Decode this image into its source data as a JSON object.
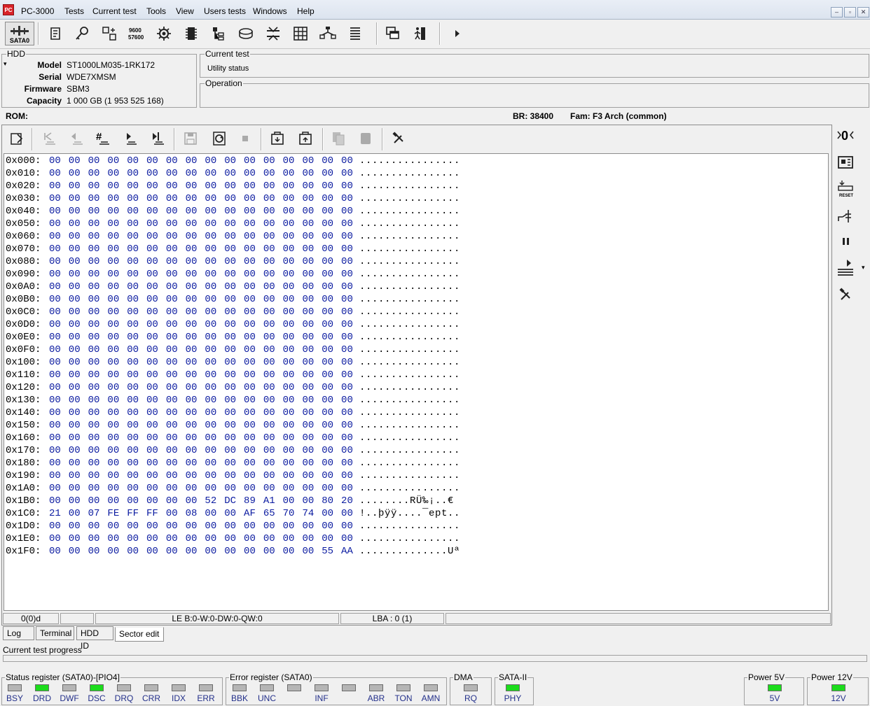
{
  "window": {
    "title_icon": "pc3000-icon",
    "menu": [
      "PC-3000",
      "Tests",
      "Current test",
      "Tools",
      "View",
      "Users tests",
      "Windows",
      "Help"
    ]
  },
  "toolbar": {
    "port_label": "SATA0"
  },
  "hdd": {
    "group_title": "HDD",
    "labels": {
      "model": "Model",
      "serial": "Serial",
      "firmware": "Firmware",
      "capacity": "Capacity"
    },
    "model": "ST1000LM035-1RK172",
    "serial": "WDE7XMSM",
    "firmware": "SBM3",
    "capacity": "1 000 GB (1 953 525 168)"
  },
  "current_test": {
    "title": "Current test",
    "value": "Utility status"
  },
  "operation": {
    "title": "Operation",
    "value": ""
  },
  "rom_line": {
    "rom": "ROM:",
    "br": "BR: 38400",
    "fam": "Fam: F3 Arch (common)"
  },
  "hex": {
    "rows": [
      {
        "addr": "0x000:",
        "bytes": "00 00 00 00 00 00 00 00 00 00 00 00 00 00 00 00",
        "ascii": "................"
      },
      {
        "addr": "0x010:",
        "bytes": "00 00 00 00 00 00 00 00 00 00 00 00 00 00 00 00",
        "ascii": "................"
      },
      {
        "addr": "0x020:",
        "bytes": "00 00 00 00 00 00 00 00 00 00 00 00 00 00 00 00",
        "ascii": "................"
      },
      {
        "addr": "0x030:",
        "bytes": "00 00 00 00 00 00 00 00 00 00 00 00 00 00 00 00",
        "ascii": "................"
      },
      {
        "addr": "0x040:",
        "bytes": "00 00 00 00 00 00 00 00 00 00 00 00 00 00 00 00",
        "ascii": "................"
      },
      {
        "addr": "0x050:",
        "bytes": "00 00 00 00 00 00 00 00 00 00 00 00 00 00 00 00",
        "ascii": "................"
      },
      {
        "addr": "0x060:",
        "bytes": "00 00 00 00 00 00 00 00 00 00 00 00 00 00 00 00",
        "ascii": "................"
      },
      {
        "addr": "0x070:",
        "bytes": "00 00 00 00 00 00 00 00 00 00 00 00 00 00 00 00",
        "ascii": "................"
      },
      {
        "addr": "0x080:",
        "bytes": "00 00 00 00 00 00 00 00 00 00 00 00 00 00 00 00",
        "ascii": "................"
      },
      {
        "addr": "0x090:",
        "bytes": "00 00 00 00 00 00 00 00 00 00 00 00 00 00 00 00",
        "ascii": "................"
      },
      {
        "addr": "0x0A0:",
        "bytes": "00 00 00 00 00 00 00 00 00 00 00 00 00 00 00 00",
        "ascii": "................"
      },
      {
        "addr": "0x0B0:",
        "bytes": "00 00 00 00 00 00 00 00 00 00 00 00 00 00 00 00",
        "ascii": "................"
      },
      {
        "addr": "0x0C0:",
        "bytes": "00 00 00 00 00 00 00 00 00 00 00 00 00 00 00 00",
        "ascii": "................"
      },
      {
        "addr": "0x0D0:",
        "bytes": "00 00 00 00 00 00 00 00 00 00 00 00 00 00 00 00",
        "ascii": "................"
      },
      {
        "addr": "0x0E0:",
        "bytes": "00 00 00 00 00 00 00 00 00 00 00 00 00 00 00 00",
        "ascii": "................"
      },
      {
        "addr": "0x0F0:",
        "bytes": "00 00 00 00 00 00 00 00 00 00 00 00 00 00 00 00",
        "ascii": "................"
      },
      {
        "addr": "0x100:",
        "bytes": "00 00 00 00 00 00 00 00 00 00 00 00 00 00 00 00",
        "ascii": "................"
      },
      {
        "addr": "0x110:",
        "bytes": "00 00 00 00 00 00 00 00 00 00 00 00 00 00 00 00",
        "ascii": "................"
      },
      {
        "addr": "0x120:",
        "bytes": "00 00 00 00 00 00 00 00 00 00 00 00 00 00 00 00",
        "ascii": "................"
      },
      {
        "addr": "0x130:",
        "bytes": "00 00 00 00 00 00 00 00 00 00 00 00 00 00 00 00",
        "ascii": "................"
      },
      {
        "addr": "0x140:",
        "bytes": "00 00 00 00 00 00 00 00 00 00 00 00 00 00 00 00",
        "ascii": "................"
      },
      {
        "addr": "0x150:",
        "bytes": "00 00 00 00 00 00 00 00 00 00 00 00 00 00 00 00",
        "ascii": "................"
      },
      {
        "addr": "0x160:",
        "bytes": "00 00 00 00 00 00 00 00 00 00 00 00 00 00 00 00",
        "ascii": "................"
      },
      {
        "addr": "0x170:",
        "bytes": "00 00 00 00 00 00 00 00 00 00 00 00 00 00 00 00",
        "ascii": "................"
      },
      {
        "addr": "0x180:",
        "bytes": "00 00 00 00 00 00 00 00 00 00 00 00 00 00 00 00",
        "ascii": "................"
      },
      {
        "addr": "0x190:",
        "bytes": "00 00 00 00 00 00 00 00 00 00 00 00 00 00 00 00",
        "ascii": "................"
      },
      {
        "addr": "0x1A0:",
        "bytes": "00 00 00 00 00 00 00 00 00 00 00 00 00 00 00 00",
        "ascii": "................"
      },
      {
        "addr": "0x1B0:",
        "bytes": "00 00 00 00 00 00 00 00 52 DC 89 A1 00 00 80 20",
        "ascii": "........RÜ‰¡..€ "
      },
      {
        "addr": "0x1C0:",
        "bytes": "21 00 07 FE FF FF 00 08 00 00 AF 65 70 74 00 00",
        "ascii": "!..þÿÿ....¯ept.."
      },
      {
        "addr": "0x1D0:",
        "bytes": "00 00 00 00 00 00 00 00 00 00 00 00 00 00 00 00",
        "ascii": "................"
      },
      {
        "addr": "0x1E0:",
        "bytes": "00 00 00 00 00 00 00 00 00 00 00 00 00 00 00 00",
        "ascii": "................"
      },
      {
        "addr": "0x1F0:",
        "bytes": "00 00 00 00 00 00 00 00 00 00 00 00 00 00 55 AA",
        "ascii": "..............Uª"
      }
    ]
  },
  "status_strip": {
    "position": "0(0)d",
    "le": "LE B:0-W:0-DW:0-QW:0",
    "lba": "LBA : 0 (1)"
  },
  "tabs": [
    "Log",
    "Terminal",
    "HDD ID",
    "Sector edit"
  ],
  "active_tab": "Sector edit",
  "progress": {
    "label": "Current test progress",
    "value": 0
  },
  "status_register": {
    "title": "Status register (SATA0)-[PIO4]",
    "leds": [
      {
        "label": "BSY",
        "on": false
      },
      {
        "label": "DRD",
        "on": true
      },
      {
        "label": "DWF",
        "on": false
      },
      {
        "label": "DSC",
        "on": true
      },
      {
        "label": "DRQ",
        "on": false
      },
      {
        "label": "CRR",
        "on": false
      },
      {
        "label": "IDX",
        "on": false
      },
      {
        "label": "ERR",
        "on": false
      }
    ]
  },
  "error_register": {
    "title": "Error register (SATA0)",
    "leds": [
      {
        "label": "BBK",
        "on": false
      },
      {
        "label": "UNC",
        "on": false
      },
      {
        "label": "",
        "on": false
      },
      {
        "label": "INF",
        "on": false
      },
      {
        "label": "",
        "on": false
      },
      {
        "label": "ABR",
        "on": false
      },
      {
        "label": "TON",
        "on": false
      },
      {
        "label": "AMN",
        "on": false
      }
    ]
  },
  "dma": {
    "title": "DMA",
    "label": "RQ",
    "on": false
  },
  "sata2": {
    "title": "SATA-II",
    "label": "PHY",
    "on": true
  },
  "power5": {
    "title": "Power 5V",
    "label": "5V",
    "on": true
  },
  "power12": {
    "title": "Power 12V",
    "label": "12V",
    "on": true
  },
  "colors": {
    "led_on": "#1cdc1c",
    "led_off": "#b5b5b5",
    "hex_bytes": "#0a1aa0",
    "led_label": "#23308a"
  }
}
